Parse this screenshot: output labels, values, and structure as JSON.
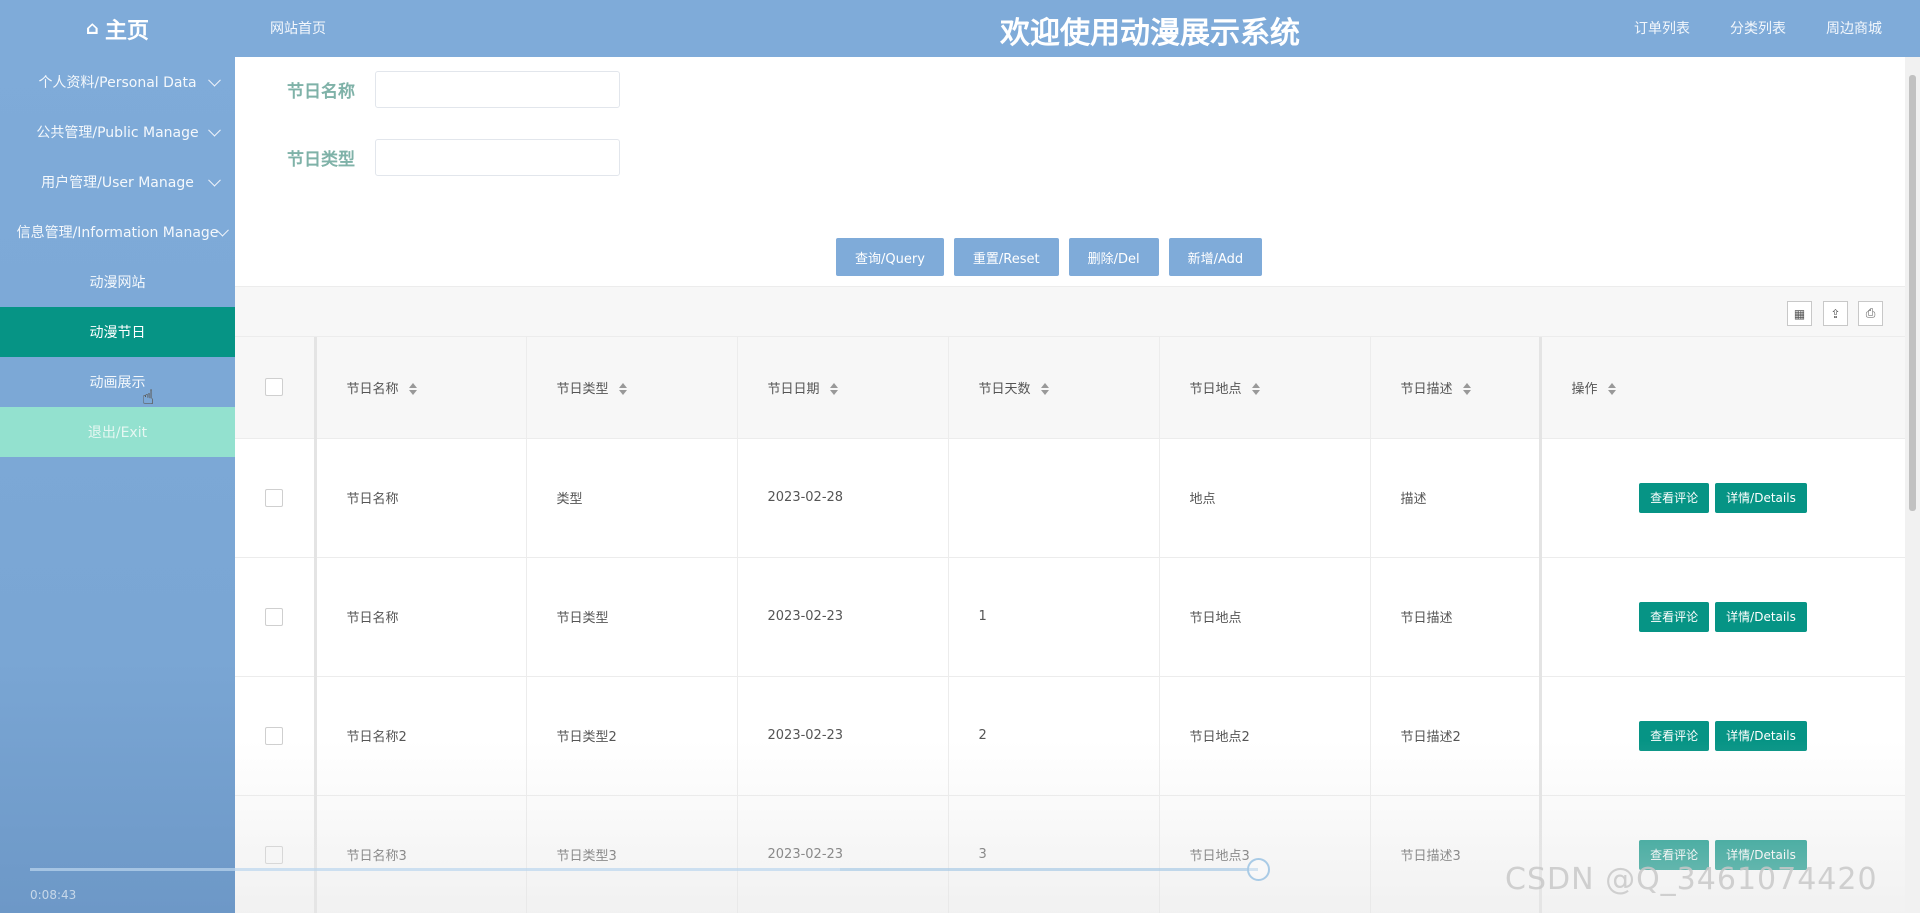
{
  "header": {
    "brand": "主页",
    "site_link": "网站首页",
    "title": "欢迎使用动漫展示系统",
    "right_links": [
      "订单列表",
      "分类列表",
      "周边商城"
    ]
  },
  "sidebar": {
    "menus": [
      {
        "label": "个人资料/Personal Data"
      },
      {
        "label": "公共管理/Public Manage"
      },
      {
        "label": "用户管理/User Manage"
      },
      {
        "label": "信息管理/Information Manage"
      }
    ],
    "subs": [
      {
        "label": "动漫网站"
      },
      {
        "label": "动漫节日"
      },
      {
        "label": "动画展示"
      },
      {
        "label": "退出/Exit"
      }
    ]
  },
  "search": {
    "fields": [
      {
        "label": "节日名称",
        "value": ""
      },
      {
        "label": "节日类型",
        "value": ""
      }
    ]
  },
  "actions": {
    "query": "查询/Query",
    "reset": "重置/Reset",
    "delete": "删除/Del",
    "add": "新增/Add"
  },
  "table": {
    "columns": [
      "节日名称",
      "节日类型",
      "节日日期",
      "节日天数",
      "节日地点",
      "节日描述",
      "操作"
    ],
    "rows": [
      {
        "name": "节日名称",
        "type": "类型",
        "date": "2023-02-28",
        "days": "",
        "place": "地点",
        "desc": "描述"
      },
      {
        "name": "节日名称",
        "type": "节日类型",
        "date": "2023-02-23",
        "days": "1",
        "place": "节日地点",
        "desc": "节日描述"
      },
      {
        "name": "节日名称2",
        "type": "节日类型2",
        "date": "2023-02-23",
        "days": "2",
        "place": "节日地点2",
        "desc": "节日描述2"
      },
      {
        "name": "节日名称3",
        "type": "节日类型3",
        "date": "2023-02-23",
        "days": "3",
        "place": "节日地点3",
        "desc": "节日描述3"
      }
    ],
    "row_actions": {
      "comments": "查看评论",
      "details": "详情/Details"
    }
  },
  "overlay": {
    "timecode": "0:08:43",
    "watermark": "CSDN @Q_3461074420",
    "progress": 0.66
  }
}
